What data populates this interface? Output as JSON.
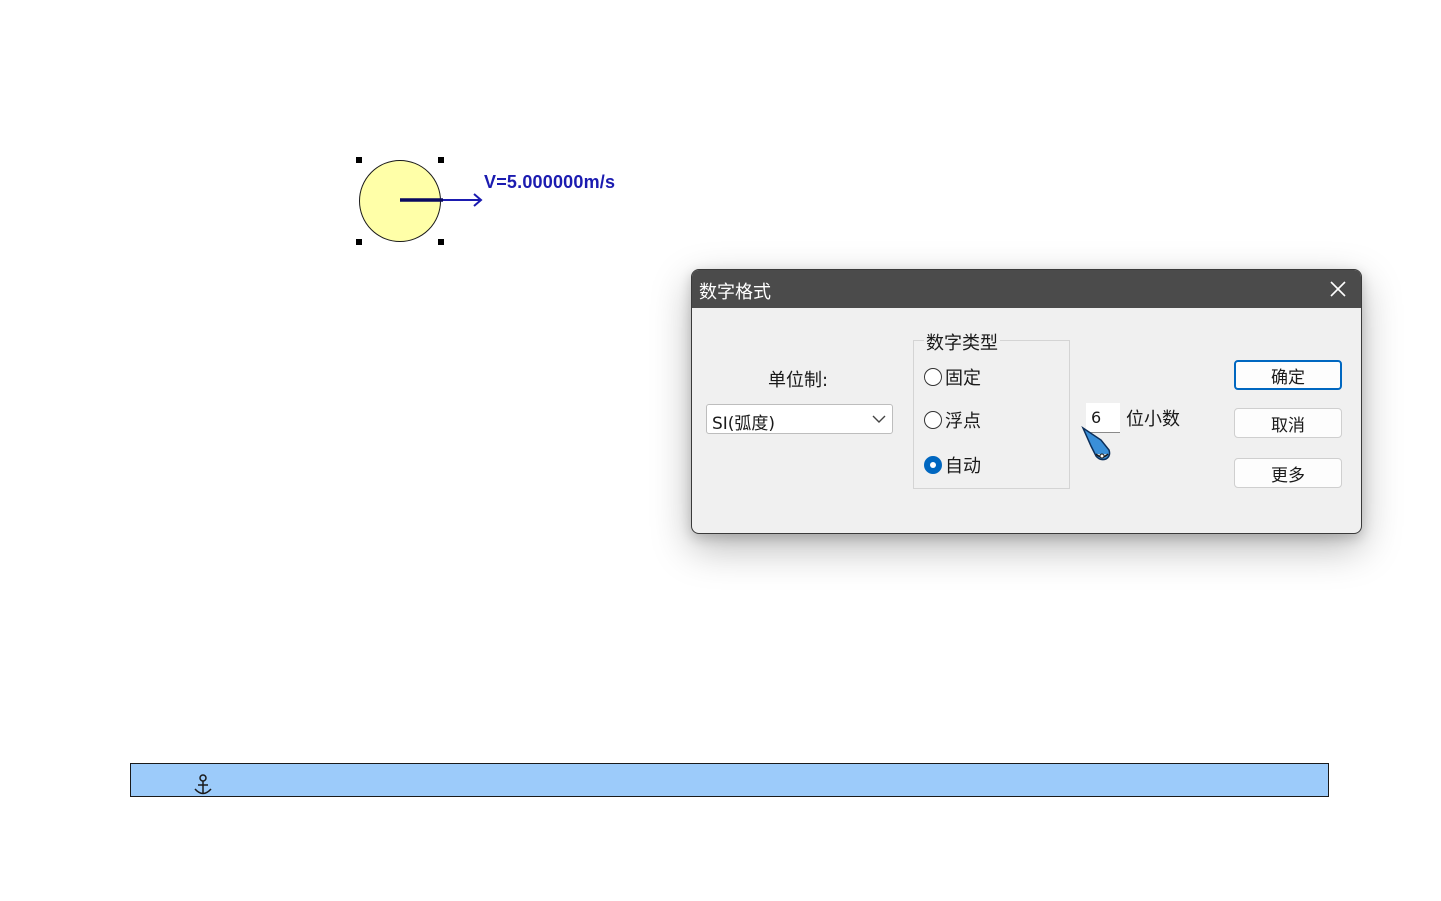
{
  "canvas": {
    "velocity_label": "V=5.000000m/s",
    "ball_color": "#ffffa8",
    "vector_color": "#1b1bb0",
    "ground_color": "#9ccbfa"
  },
  "dialog": {
    "title": "数字格式",
    "close_icon": "close-icon",
    "unit_label": "单位制:",
    "unit_value": "SI(弧度)",
    "number_type": {
      "title": "数字类型",
      "options": [
        {
          "label": "固定",
          "checked": false
        },
        {
          "label": "浮点",
          "checked": false
        },
        {
          "label": "自动",
          "checked": true
        }
      ]
    },
    "digits_value": "6",
    "digits_label": "位小数",
    "buttons": {
      "ok": "确定",
      "cancel": "取消",
      "more": "更多"
    },
    "accent_color": "#0067c0",
    "titlebar_color": "#4b4b4b"
  }
}
